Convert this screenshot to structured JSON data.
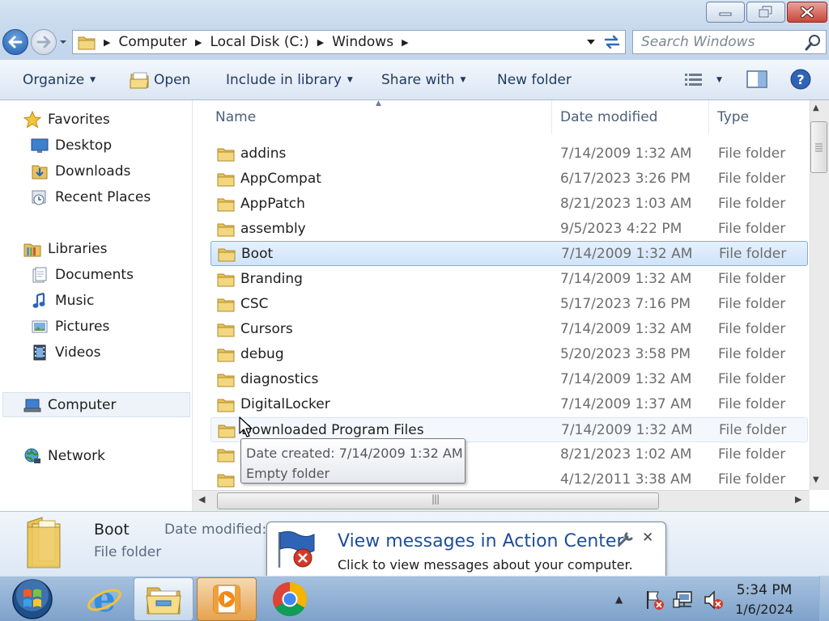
{
  "window": {
    "breadcrumb": [
      "Computer",
      "Local Disk (C:)",
      "Windows"
    ],
    "search_placeholder": "Search Windows"
  },
  "toolbar": {
    "organize": "Organize",
    "open": "Open",
    "include_in_library": "Include in library",
    "share_with": "Share with",
    "new_folder": "New folder"
  },
  "navpane": {
    "favorites": "Favorites",
    "desktop": "Desktop",
    "downloads": "Downloads",
    "recent_places": "Recent Places",
    "libraries": "Libraries",
    "documents": "Documents",
    "music": "Music",
    "pictures": "Pictures",
    "videos": "Videos",
    "computer": "Computer",
    "network": "Network"
  },
  "columns": {
    "name": "Name",
    "date_modified": "Date modified",
    "type": "Type"
  },
  "files": [
    {
      "name": "addins",
      "date": "7/14/2009 1:32 AM",
      "type": "File folder"
    },
    {
      "name": "AppCompat",
      "date": "6/17/2023 3:26 PM",
      "type": "File folder"
    },
    {
      "name": "AppPatch",
      "date": "8/21/2023 1:03 AM",
      "type": "File folder"
    },
    {
      "name": "assembly",
      "date": "9/5/2023 4:22 PM",
      "type": "File folder"
    },
    {
      "name": "Boot",
      "date": "7/14/2009 1:32 AM",
      "type": "File folder",
      "selected": true
    },
    {
      "name": "Branding",
      "date": "7/14/2009 1:32 AM",
      "type": "File folder"
    },
    {
      "name": "CSC",
      "date": "5/17/2023 7:16 PM",
      "type": "File folder"
    },
    {
      "name": "Cursors",
      "date": "7/14/2009 1:32 AM",
      "type": "File folder"
    },
    {
      "name": "debug",
      "date": "5/20/2023 3:58 PM",
      "type": "File folder"
    },
    {
      "name": "diagnostics",
      "date": "7/14/2009 1:32 AM",
      "type": "File folder"
    },
    {
      "name": "DigitalLocker",
      "date": "7/14/2009 1:37 AM",
      "type": "File folder"
    },
    {
      "name": "Downloaded Program Files",
      "date": "7/14/2009 1:32 AM",
      "type": "File folder",
      "hover": true
    },
    {
      "name": "",
      "date": "8/21/2023 1:02 AM",
      "type": "File folder"
    },
    {
      "name": "",
      "date": "4/12/2011 3:38 AM",
      "type": "File folder"
    }
  ],
  "tooltip": {
    "line1": "Date created: 7/14/2009 1:32 AM",
    "line2": "Empty folder"
  },
  "details": {
    "name": "Boot",
    "type": "File folder",
    "date_label": "Date modified:"
  },
  "notification": {
    "title": "View messages in Action Center",
    "body": "Click to view messages about your computer."
  },
  "clock": {
    "time": "5:34 PM",
    "date": "1/6/2024"
  },
  "colors": {
    "selection": "#cfe3f9",
    "link_blue": "#1f4d9b",
    "taskbar": "#7ea2cb"
  }
}
